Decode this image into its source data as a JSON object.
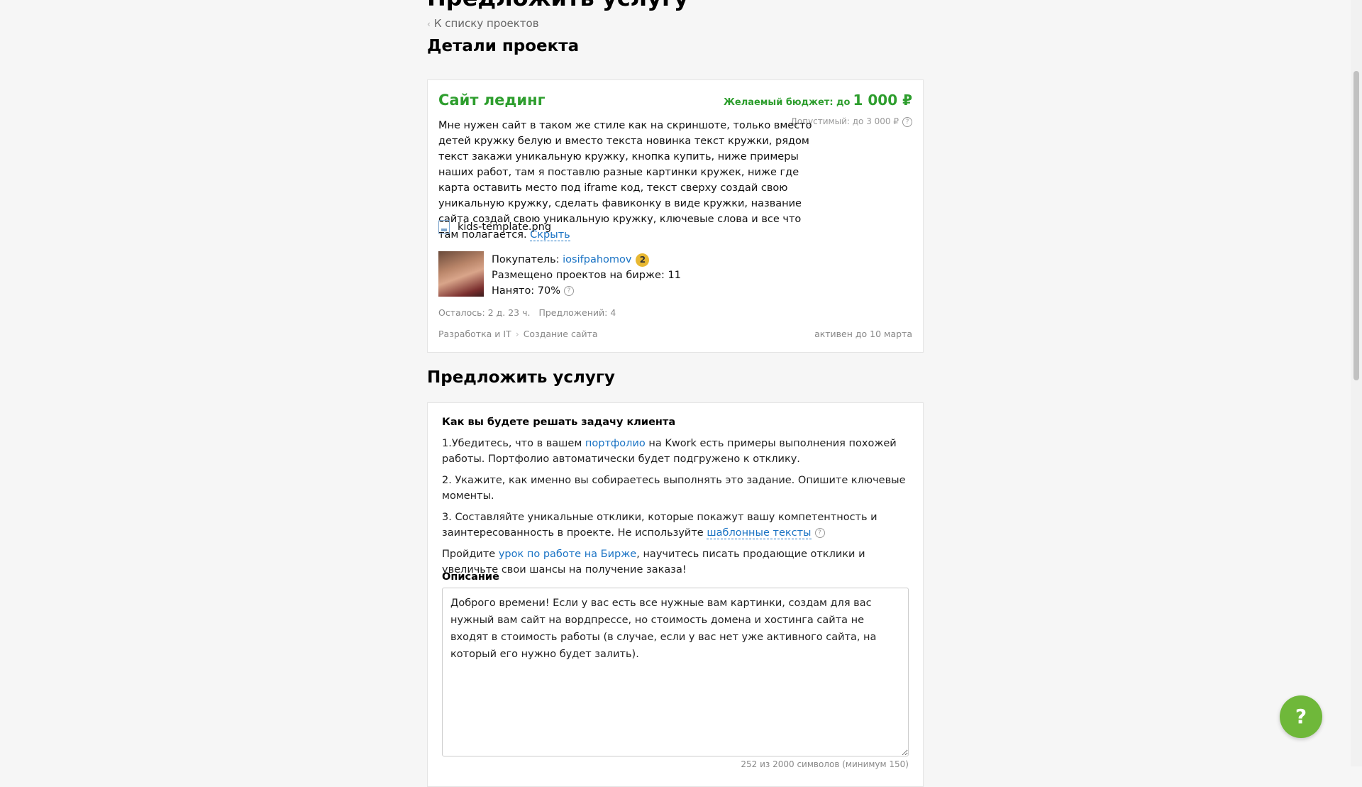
{
  "page": {
    "title": "Предложить услугу",
    "back_link": "К списку проектов",
    "details_heading": "Детали проекта",
    "offer_heading": "Предложить услугу"
  },
  "project": {
    "title": "Сайт лединг",
    "budget_label": "Желаемый бюджет: до",
    "budget_amount": "1 000 ₽",
    "allowed": "Допустимый: до 3 000 ₽",
    "description": "Мне нужен сайт в таком же стиле как на скриншоте, только вместо детей кружку белую и вместо текста новинка текст кружки, рядом текст закажи уникальную кружку, кнопка купить, ниже примеры наших работ, там я поставлю разные картинки кружек, ниже где карта оставить место под iframe код, текст сверху создай свою уникальную кружку, сделать фавиконку в виде кружки, название сайта создай свою уникальную кружку, ключевые слова и все что там полагается.",
    "hide_link": "Скрыть",
    "attachment": "kids-template.png",
    "buyer_label": "Покупатель:",
    "buyer_name": "iosifpahomov",
    "buyer_badge": "2",
    "projects_posted": "Размещено проектов на бирже: 11",
    "hired": "Нанято: 70%",
    "time_left": "Осталось: 2 д. 23 ч.",
    "offers": "Предложений: 4",
    "category": "Разработка и IT",
    "subcategory": "Создание сайта",
    "active_until": "активен до 10 марта"
  },
  "offer": {
    "heading": "Как вы будете решать задачу клиента",
    "step1_a": "1.Убедитесь, что в вашем ",
    "step1_link": "портфолио",
    "step1_b": " на Kwork есть примеры выполнения похожей работы. Портфолио автоматически будет подгружено к отклику.",
    "step2": "2. Укажите, как именно вы собираетесь выполнять это задание. Опишите ключевые моменты.",
    "step3_a": "3. Составляйте уникальные отклики, которые покажут вашу компетентность и заинтересованность в проекте. Не используйте ",
    "step3_link": "шаблонные тексты",
    "lesson_a": "Пройдите ",
    "lesson_link": "урок по работе на Бирже",
    "lesson_b": ", научитесь писать продающие отклики и увеличьте свои шансы на получение заказа!",
    "description_label": "Описание",
    "description_value": "Доброго времени! Если у вас есть все нужные вам картинки, создам для вас нужный вам сайт на вордпрессе, но стоимость домена и хостинга сайта не входят в стоимость работы (в случае, если у вас нет уже активного сайта, на который его нужно будет залить).",
    "counter": "252 из 2000 символов (минимум 150)"
  },
  "help_button": "?",
  "colors": {
    "green": "#2e9e2e",
    "link": "#1a73c4",
    "help": "#6fb83a"
  }
}
